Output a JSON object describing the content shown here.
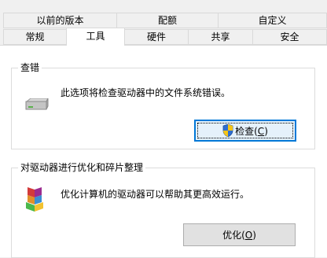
{
  "tabs_row1": [
    {
      "label": "以前的版本"
    },
    {
      "label": "配额"
    },
    {
      "label": "自定义"
    }
  ],
  "tabs_row2": [
    {
      "label": "常规"
    },
    {
      "label": "工具",
      "active": true
    },
    {
      "label": "硬件"
    },
    {
      "label": "共享"
    },
    {
      "label": "安全"
    }
  ],
  "error_check": {
    "title": "查错",
    "description": "此选项将检查驱动器中的文件系统错误。",
    "button_label": "检查(",
    "button_accel": "C",
    "button_tail": ")",
    "icon": "drive-icon",
    "button_icon": "uac-shield-icon"
  },
  "optimize": {
    "title": "对驱动器进行优化和碎片整理",
    "description": "优化计算机的驱动器可以帮助其更高效运行。",
    "button_label": "优化(",
    "button_accel": "O",
    "button_tail": ")",
    "icon": "defrag-icon"
  },
  "colors": {
    "focus_border": "#0078d7",
    "panel_bg": "#ffffff",
    "window_bg": "#f0f0f0"
  }
}
